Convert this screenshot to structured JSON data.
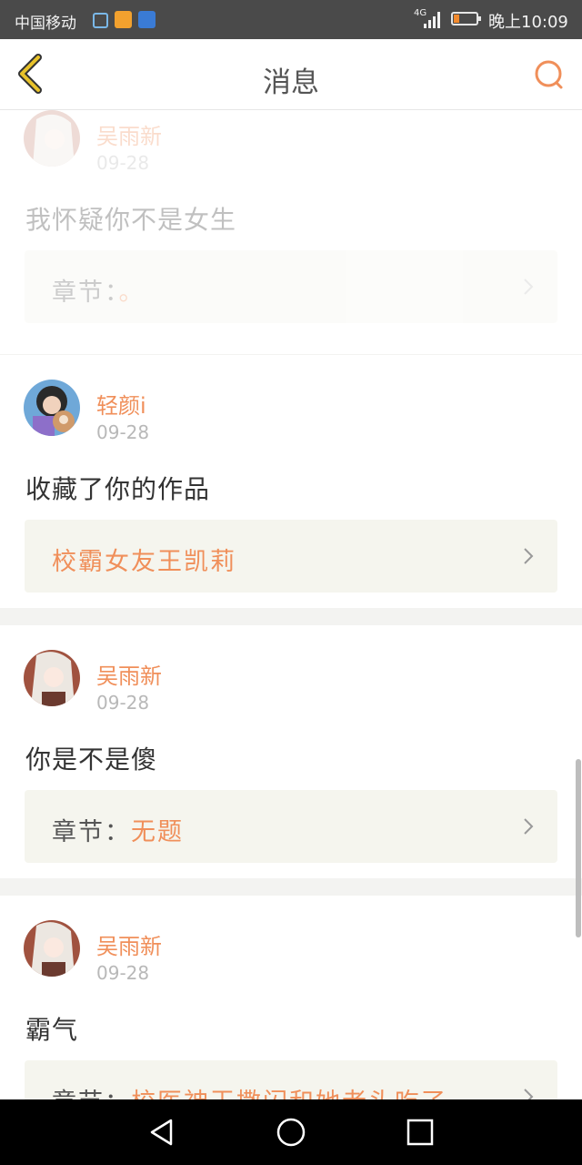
{
  "status_bar": {
    "carrier": "中国移动",
    "network": "4G",
    "time": "晚上10:09",
    "icons": [
      "lock-icon",
      "app-notification-icon",
      "shield-icon",
      "signal-icon",
      "battery-icon"
    ]
  },
  "header": {
    "title": "消息",
    "back_icon": "chevron-left-icon",
    "search_icon": "search-icon"
  },
  "messages": [
    {
      "username": "吴雨新",
      "date": "09-28",
      "text": "我怀疑你不是女生",
      "link_prefix": "章节：",
      "link_value": "。"
    },
    {
      "username": "轻颜i",
      "date": "09-28",
      "text": "收藏了你的作品",
      "link_prefix": "",
      "link_value": "校霸女友王凯莉"
    },
    {
      "username": "吴雨新",
      "date": "09-28",
      "text": "你是不是傻",
      "link_prefix": "章节：",
      "link_value": "无题"
    },
    {
      "username": "吴雨新",
      "date": "09-28",
      "text": "霸气",
      "link_prefix": "章节：",
      "link_value": "校医神王撒闪和她老头吃了"
    }
  ],
  "colors": {
    "accent": "#f08f5a",
    "back_arrow": "#e8c22a",
    "link_box": "#f5f5ee",
    "divider": "#f3f3f1"
  }
}
